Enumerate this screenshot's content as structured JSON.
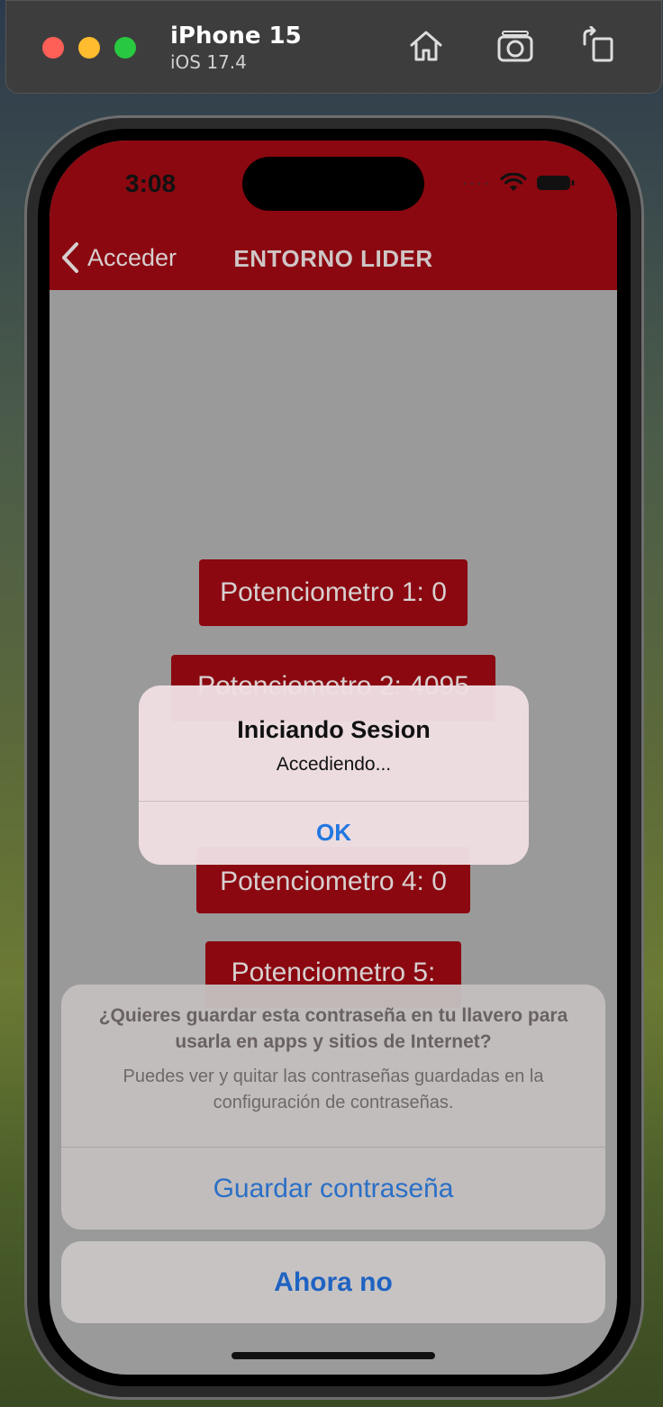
{
  "simulator": {
    "device_name": "iPhone 15",
    "os_version": "iOS 17.4",
    "icons": [
      "home-icon",
      "screenshot-icon",
      "rotate-icon"
    ]
  },
  "status_bar": {
    "time": "3:08"
  },
  "nav": {
    "back_label": "Acceder",
    "title": "ENTORNO LIDER",
    "color": "#8b0810"
  },
  "potentiometers": [
    "Potenciometro 1: 0",
    "Potenciometro 2: 4095",
    "Potenciometro 4: 0",
    "Potenciometro 5:"
  ],
  "alert": {
    "title": "Iniciando Sesion",
    "message": "Accediendo...",
    "ok_label": "OK"
  },
  "password_sheet": {
    "question": "¿Quieres guardar esta contraseña en tu llavero para usarla en apps y sitios de Internet?",
    "description": "Puedes ver y quitar las contraseñas guardadas en la configuración de contraseñas.",
    "save_label": "Guardar contraseña",
    "cancel_label": "Ahora no"
  }
}
